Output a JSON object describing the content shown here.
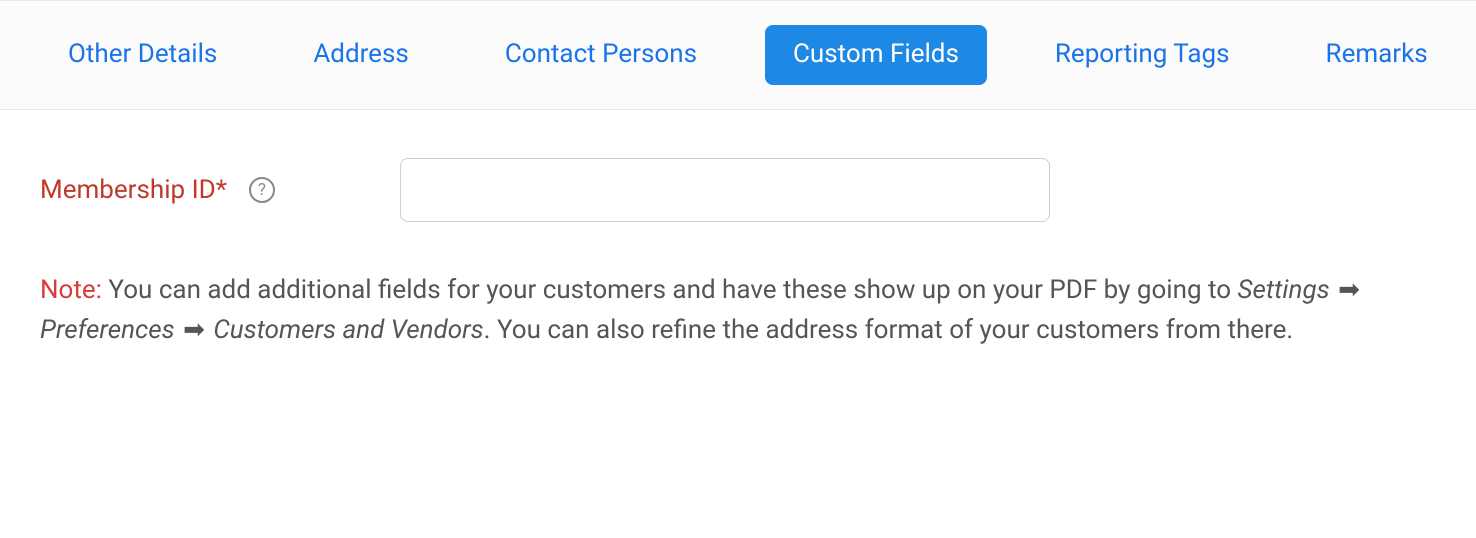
{
  "tabs": [
    {
      "label": "Other Details",
      "active": false
    },
    {
      "label": "Address",
      "active": false
    },
    {
      "label": "Contact Persons",
      "active": false
    },
    {
      "label": "Custom Fields",
      "active": true
    },
    {
      "label": "Reporting Tags",
      "active": false
    },
    {
      "label": "Remarks",
      "active": false
    }
  ],
  "field": {
    "label": "Membership ID*",
    "help_glyph": "?",
    "value": ""
  },
  "note": {
    "prefix": "Note:",
    "text_before_path": "You can add additional fields for your customers and have these show up on your PDF by going to ",
    "path": [
      "Settings",
      "Preferences",
      "Customers and Vendors"
    ],
    "path_suffix": ".",
    "text_after_path": " You can also refine the address format of your customers from there."
  }
}
